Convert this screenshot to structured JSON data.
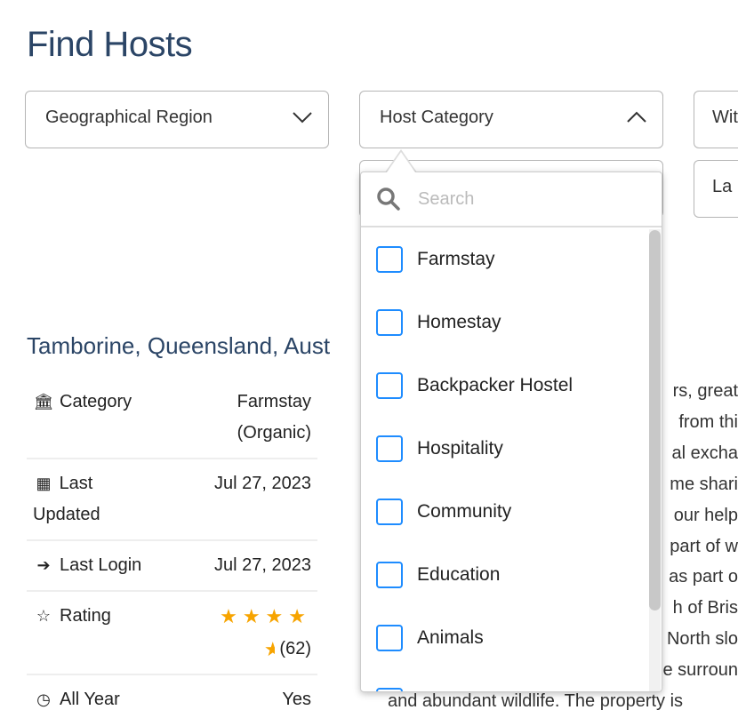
{
  "title": "Find Hosts",
  "filters": [
    {
      "label": "Geographical Region",
      "state": "collapsed"
    },
    {
      "label": "Host Category",
      "state": "expanded"
    },
    {
      "label": "Wit"
    },
    {
      "label": "La"
    }
  ],
  "dropdown": {
    "search_placeholder": "Search",
    "options": [
      "Farmstay",
      "Homestay",
      "Backpacker Hostel",
      "Hospitality",
      "Community",
      "Education",
      "Animals"
    ],
    "checkbox_color": "#1e8cff"
  },
  "listing": {
    "location": "Tamborine, Queensland, Aust",
    "details": [
      {
        "icon": "bank-icon",
        "label": "Category",
        "value": "Farmstay (Organic)"
      },
      {
        "icon": "calendar-icon",
        "label": "Last Updated",
        "value": "Jul 27, 2023"
      },
      {
        "icon": "sign-in-icon",
        "label": "Last Login",
        "value": "Jul 27, 2023"
      },
      {
        "icon": "star-outline-icon",
        "label": "Rating",
        "rating": 4.5,
        "count": "(62)"
      },
      {
        "icon": "clock-icon",
        "label": "All Year",
        "value": "Yes"
      }
    ],
    "description_fragments": [
      "rs, great",
      "from thi",
      "al excha",
      "me shari",
      "our help",
      "part of w",
      "as part o",
      "h of Bris",
      "North slo",
      "e surroun",
      "and abundant wildlife. The property is"
    ]
  },
  "colors": {
    "title": "#2b4566",
    "star": "#f7a400"
  }
}
